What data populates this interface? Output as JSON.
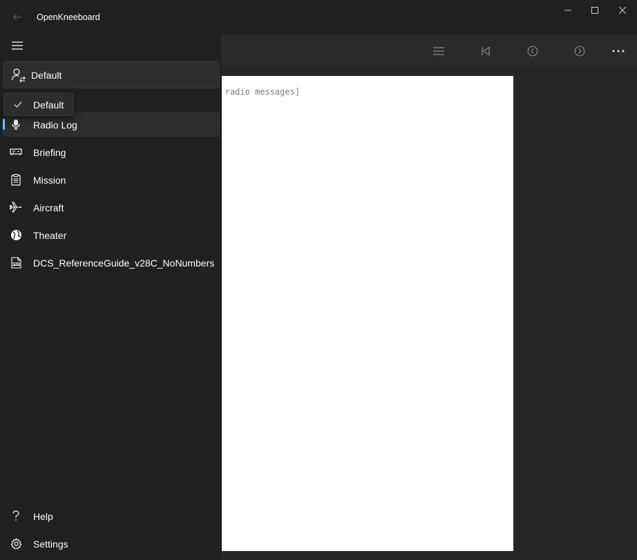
{
  "window": {
    "title": "OpenKneeboard"
  },
  "toolbar": {
    "icons": [
      "contents-icon",
      "first-page-icon",
      "previous-page-icon",
      "next-page-icon",
      "more-icon"
    ]
  },
  "page": {
    "text": "or radio messages]"
  },
  "profile": {
    "label": "Default",
    "dropdown_item": "Default"
  },
  "nav": {
    "items": [
      {
        "label": "Radio Log",
        "icon": "microphone-icon",
        "selected": true
      },
      {
        "label": "Briefing",
        "icon": "briefing-icon"
      },
      {
        "label": "Mission",
        "icon": "clipboard-icon"
      },
      {
        "label": "Aircraft",
        "icon": "airplane-icon"
      },
      {
        "label": "Theater",
        "icon": "globe-icon"
      },
      {
        "label": "DCS_ReferenceGuide_v28C_NoNumbers",
        "icon": "pdf-icon"
      }
    ],
    "footer": [
      {
        "label": "Help",
        "icon": "help-icon"
      },
      {
        "label": "Settings",
        "icon": "gear-icon"
      }
    ]
  },
  "colors": {
    "accent": "#60cdff",
    "background": "#202020",
    "pane_selected": "#2d2d2d"
  }
}
